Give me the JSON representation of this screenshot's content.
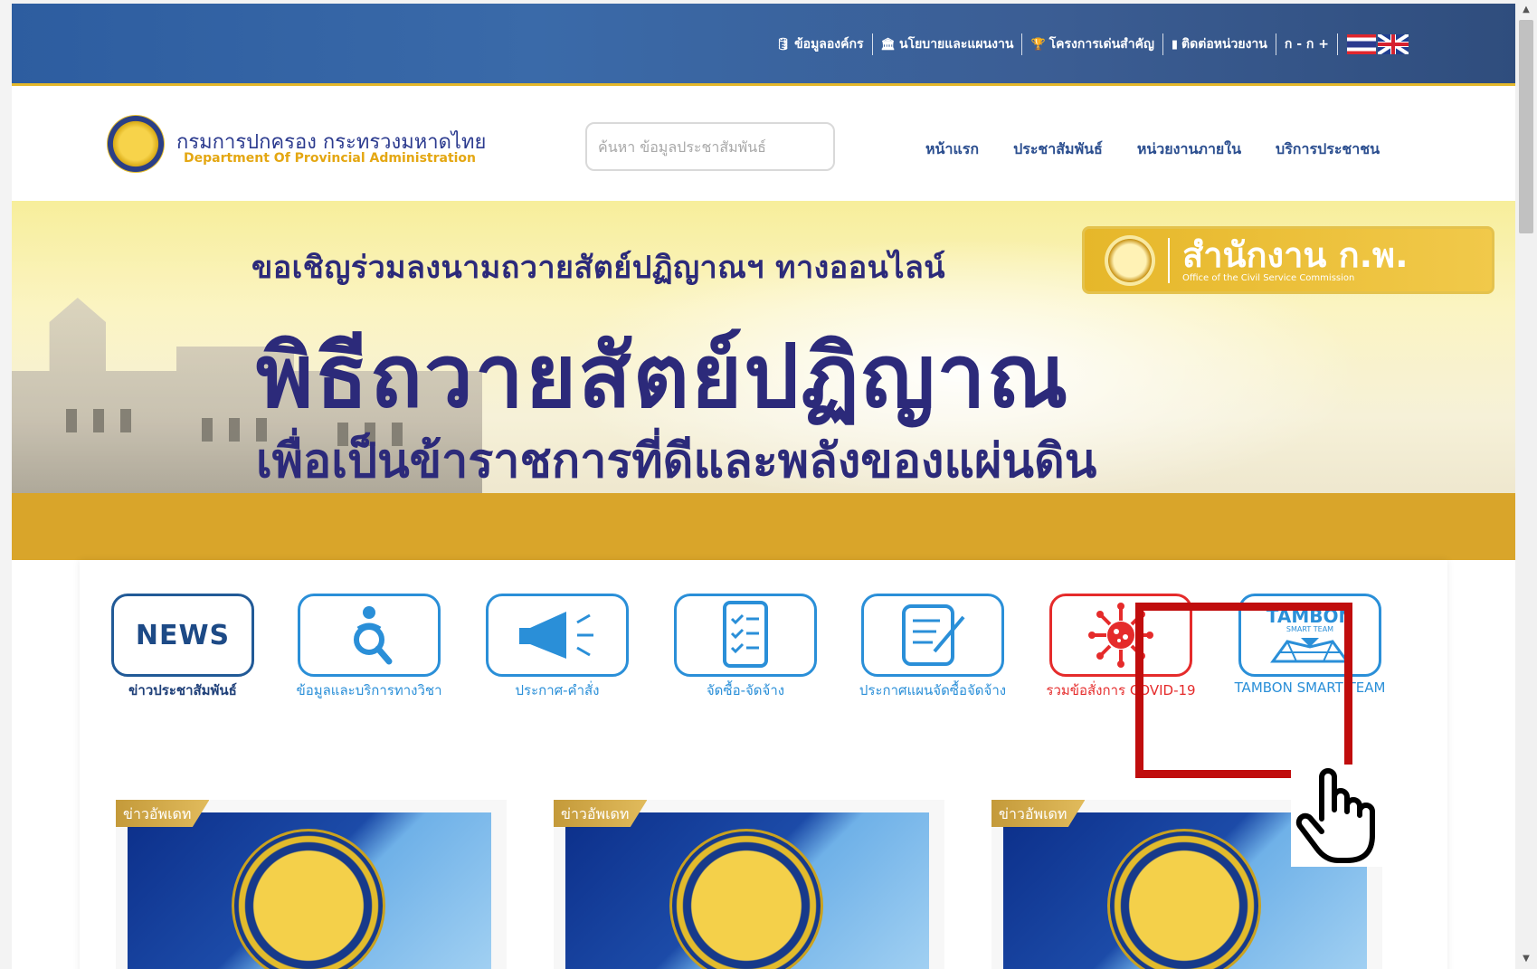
{
  "topnav": {
    "items": [
      {
        "icon": "database-icon",
        "label": "ข้อมูลองค์กร"
      },
      {
        "icon": "building-icon",
        "label": "นโยบายและแผนงาน"
      },
      {
        "icon": "trophy-icon",
        "label": "โครงการเด่นสำคัญ"
      },
      {
        "icon": "phonebook-icon",
        "label": "ติดต่อหน่วยงาน"
      }
    ],
    "font_size_label": "ก - ก +"
  },
  "header": {
    "brand_th": "กรมการปกครอง กระทรวงมหาดไทย",
    "brand_en": "Department Of Provincial Administration",
    "search_placeholder": "ค้นหา ข้อมูลประชาสัมพันธ์",
    "nav": [
      "หน้าแรก",
      "ประชาสัมพันธ์",
      "หน่วยงานภายใน",
      "บริการประชาชน"
    ]
  },
  "banner": {
    "line1": "ขอเชิญร่วมลงนามถวายสัตย์ปฏิญาณฯ ทางออนไลน์",
    "line2": "พิธีถวายสัตย์ปฏิญาณ",
    "line3": "เพื่อเป็นข้าราชการที่ดีและพลังของแผ่นดิน",
    "ocsc_th": "สำนักงาน ก.พ.",
    "ocsc_en": "Office of the Civil Service Commission"
  },
  "services": [
    {
      "label": "ข่าวประชาสัมพันธ์",
      "icon_text": "NEWS"
    },
    {
      "label": "ข้อมูลและบริการทางวิชา"
    },
    {
      "label": "ประกาศ-คำสั่ง"
    },
    {
      "label": "จัดซื้อ-จัดจ้าง"
    },
    {
      "label": "ประกาศแผนจัดซื้อจัดจ้าง"
    },
    {
      "label": "รวมข้อสั่งการ COVID-19"
    },
    {
      "label": "TAMBON SMART TEAM",
      "icon_text": "TAMBON",
      "icon_subtext": "SMART TEAM"
    }
  ],
  "news_cards": [
    {
      "tag": "ข่าวอัพเดท"
    },
    {
      "tag": "ข่าวอัพเดท"
    },
    {
      "tag": "ข่าวอัพเดท"
    }
  ],
  "colors": {
    "topbar": "#3a6aa9",
    "accent_gold": "#e4b82b",
    "nav_blue": "#2b4e8f",
    "service_blue": "#2a8fd8",
    "covid_red": "#e52b2b",
    "highlight_red": "#c00d0d"
  }
}
